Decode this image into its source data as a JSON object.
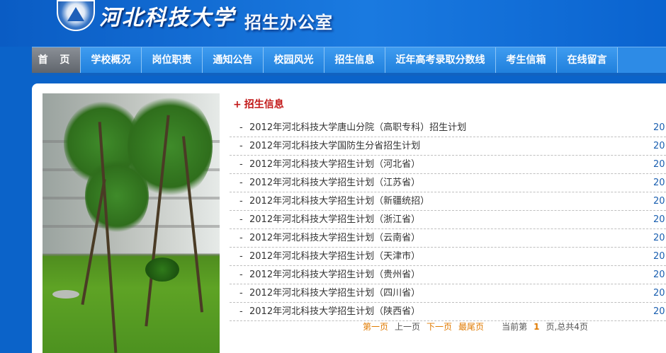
{
  "header": {
    "school_name": "河北科技大学",
    "office_name": "招生办公室",
    "logo": "school-emblem"
  },
  "nav": {
    "items": [
      {
        "label": "首 页",
        "active": true
      },
      {
        "label": "学校概况"
      },
      {
        "label": "岗位职责"
      },
      {
        "label": "通知公告"
      },
      {
        "label": "校园风光"
      },
      {
        "label": "招生信息"
      },
      {
        "label": "近年高考录取分数线"
      },
      {
        "label": "考生信箱"
      },
      {
        "label": "在线留言"
      }
    ]
  },
  "news": {
    "section_title": "招生信息",
    "plus": "+",
    "bullet": "-",
    "items": [
      {
        "title": "2012年河北科技大学唐山分院（高职专科）招生计划",
        "date": "20"
      },
      {
        "title": "2012年河北科技大学国防生分省招生计划",
        "date": "20"
      },
      {
        "title": "2012年河北科技大学招生计划（河北省）",
        "date": "20"
      },
      {
        "title": "2012年河北科技大学招生计划（江苏省）",
        "date": "20"
      },
      {
        "title": "2012年河北科技大学招生计划（新疆统招）",
        "date": "20"
      },
      {
        "title": "2012年河北科技大学招生计划（浙江省）",
        "date": "20"
      },
      {
        "title": "2012年河北科技大学招生计划（云南省）",
        "date": "20"
      },
      {
        "title": "2012年河北科技大学招生计划（天津市）",
        "date": "20"
      },
      {
        "title": "2012年河北科技大学招生计划（贵州省）",
        "date": "20"
      },
      {
        "title": "2012年河北科技大学招生计划（四川省）",
        "date": "20"
      },
      {
        "title": "2012年河北科技大学招生计划（陕西省）",
        "date": "20"
      }
    ]
  },
  "pager": {
    "first": "第一页",
    "prev": "上一页",
    "next": "下一页",
    "last": "最尾页",
    "info_prefix": "当前第",
    "current_page": "1",
    "info_suffix": "页,总共4页"
  },
  "colors": {
    "background": "#0b63c9",
    "nav": "#2d8be6",
    "nav_active": "#6f747b",
    "section_title": "#c21818",
    "pager_link": "#e07a00",
    "date": "#1a5fb0"
  }
}
